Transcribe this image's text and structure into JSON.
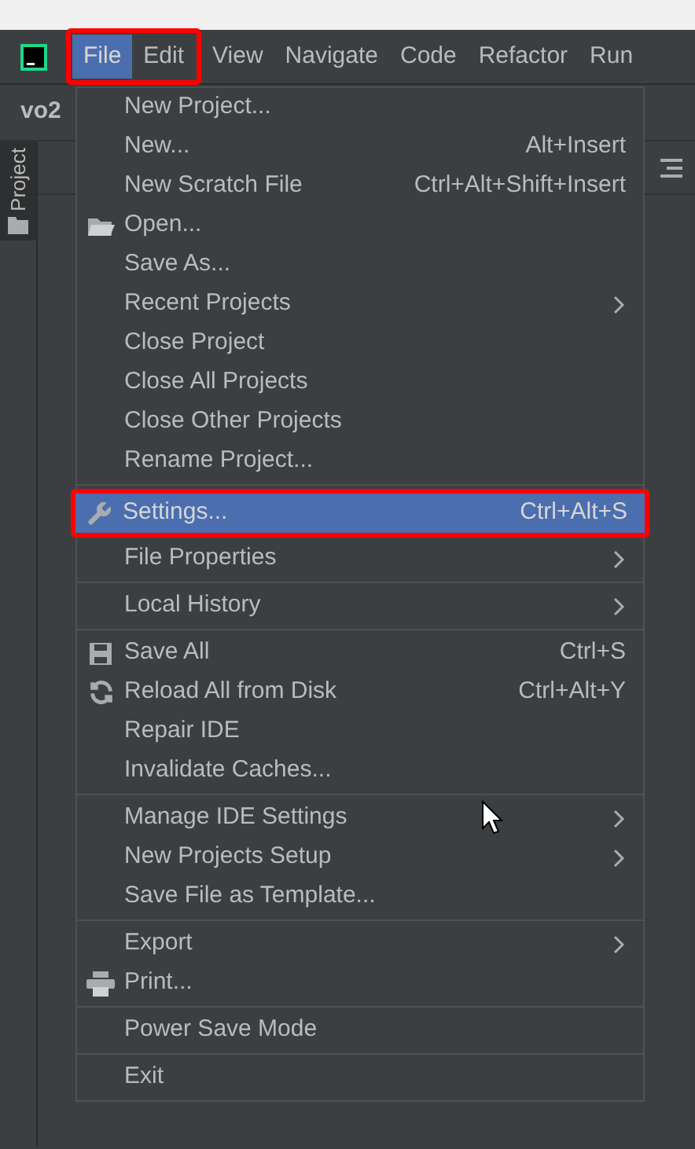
{
  "project_name": "vo2",
  "menubar": [
    {
      "label": "File",
      "selected": true,
      "framed": true
    },
    {
      "label": "Edit",
      "selected": false,
      "framed": true
    },
    {
      "label": "View",
      "selected": false,
      "framed": false
    },
    {
      "label": "Navigate",
      "selected": false,
      "framed": false
    },
    {
      "label": "Code",
      "selected": false,
      "framed": false
    },
    {
      "label": "Refactor",
      "selected": false,
      "framed": false
    },
    {
      "label": "Run",
      "selected": false,
      "framed": false
    }
  ],
  "tool_window_tab": {
    "label": "Project",
    "selected": true
  },
  "file_menu": [
    [
      {
        "label": "New Project...",
        "selected": false,
        "submenu": false,
        "framed": false
      },
      {
        "label": "New...",
        "shortcut": "Alt+Insert",
        "selected": false,
        "submenu": false,
        "framed": false
      },
      {
        "label": "New Scratch File",
        "shortcut": "Ctrl+Alt+Shift+Insert",
        "selected": false,
        "submenu": false,
        "framed": false
      },
      {
        "label": "Open...",
        "kind": "folder",
        "selected": false,
        "submenu": false,
        "framed": false
      },
      {
        "label": "Save As...",
        "selected": false,
        "submenu": false,
        "framed": false
      },
      {
        "label": "Recent Projects",
        "submenu": true,
        "selected": false,
        "framed": false
      },
      {
        "label": "Close Project",
        "selected": false,
        "submenu": false,
        "framed": false
      },
      {
        "label": "Close All Projects",
        "selected": false,
        "submenu": false,
        "framed": false
      },
      {
        "label": "Close Other Projects",
        "selected": false,
        "submenu": false,
        "framed": false
      },
      {
        "label": "Rename Project...",
        "selected": false,
        "submenu": false,
        "framed": false
      }
    ],
    [
      {
        "label": "Settings...",
        "kind": "wrench",
        "shortcut": "Ctrl+Alt+S",
        "selected": true,
        "submenu": false,
        "framed": true
      },
      {
        "label": "File Properties",
        "submenu": true,
        "selected": false,
        "framed": false
      }
    ],
    [
      {
        "label": "Local History",
        "submenu": true,
        "selected": false,
        "framed": false
      }
    ],
    [
      {
        "label": "Save All",
        "kind": "save",
        "shortcut": "Ctrl+S",
        "selected": false,
        "submenu": false,
        "framed": false
      },
      {
        "label": "Reload All from Disk",
        "kind": "reload",
        "shortcut": "Ctrl+Alt+Y",
        "selected": false,
        "submenu": false,
        "framed": false
      },
      {
        "label": "Repair IDE",
        "selected": false,
        "submenu": false,
        "framed": false
      },
      {
        "label": "Invalidate Caches...",
        "selected": false,
        "submenu": false,
        "framed": false
      }
    ],
    [
      {
        "label": "Manage IDE Settings",
        "submenu": true,
        "selected": false,
        "framed": false
      },
      {
        "label": "New Projects Setup",
        "submenu": true,
        "selected": false,
        "framed": false
      },
      {
        "label": "Save File as Template...",
        "selected": false,
        "submenu": false,
        "framed": false
      }
    ],
    [
      {
        "label": "Export",
        "submenu": true,
        "selected": false,
        "framed": false
      },
      {
        "label": "Print...",
        "kind": "print",
        "selected": false,
        "submenu": false,
        "framed": false
      }
    ],
    [
      {
        "label": "Power Save Mode",
        "selected": false,
        "submenu": false,
        "framed": false
      }
    ],
    [
      {
        "label": "Exit",
        "selected": false,
        "submenu": false,
        "framed": false
      }
    ]
  ]
}
